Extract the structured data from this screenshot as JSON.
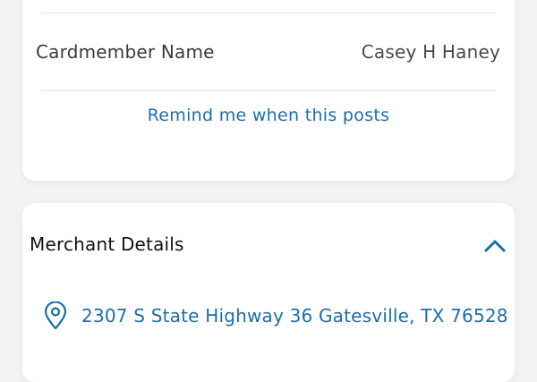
{
  "card_details": {
    "cardmember_label": "Cardmember Name",
    "cardmember_value": "Casey H Haney",
    "remind_link": "Remind me when this posts"
  },
  "merchant": {
    "section_title": "Merchant Details",
    "address": "2307 S State Highway 36 Gatesville, TX 76528",
    "collapse_icon": "chevron-up-icon",
    "pin_icon": "location-pin-icon"
  },
  "colors": {
    "link": "#1a6fa8",
    "background": "#f3f3f3",
    "card": "#ffffff",
    "divider": "#e2e2e2"
  }
}
